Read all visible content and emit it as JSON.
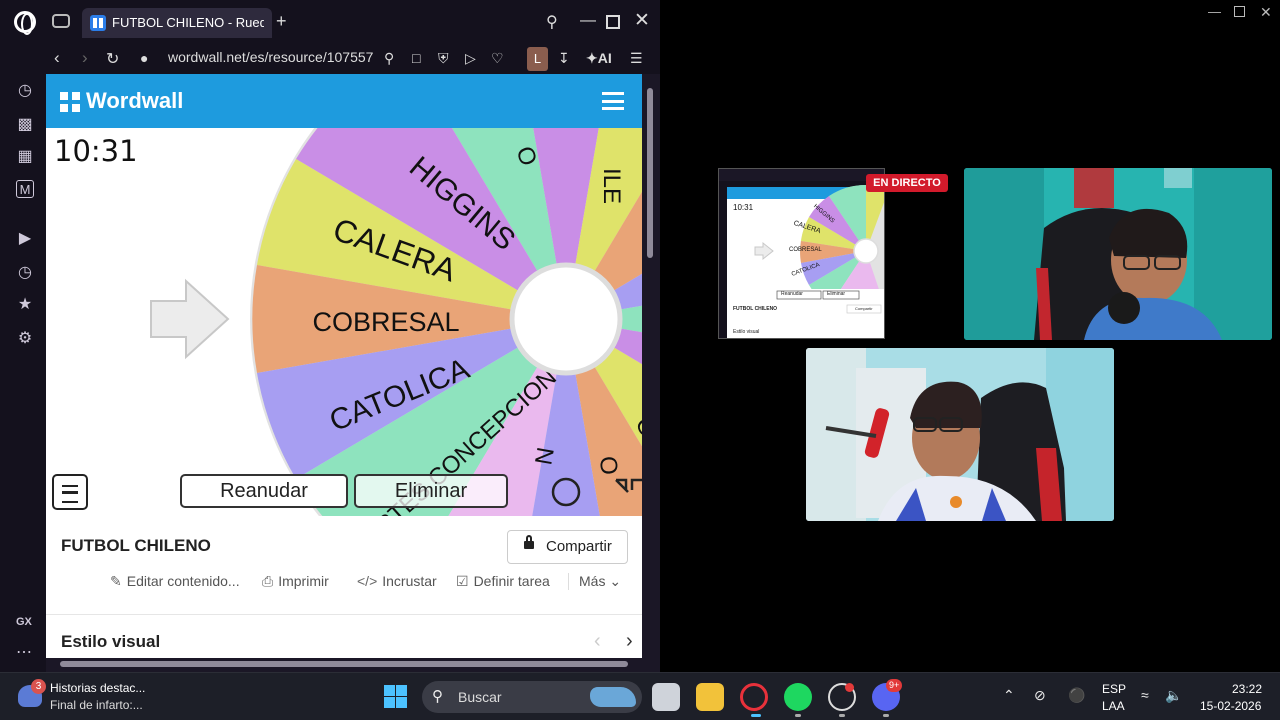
{
  "browser": {
    "tab_title": "FUTBOL CHILENO - Rueda",
    "url": "wordwall.net/es/resource/107557",
    "profile_initial": "L",
    "ai_label": "AI",
    "sidebar_gx": "GX"
  },
  "wordwall": {
    "logo": "Wordwall",
    "timer": "10:31",
    "wheel_segments": [
      "HIGGINS",
      "CALERA",
      "COBRESAL",
      "CATOLICA",
      "DEPORTES CONCEPCION"
    ],
    "wheel_top_fragments": [
      "O",
      "ILE",
      "V"
    ],
    "wheel_lower_fragments": [
      "N",
      "O",
      "Q",
      "NO"
    ],
    "resume_button": "Reanudar",
    "eliminate_button": "Eliminar",
    "activity_title": "FUTBOL CHILENO",
    "share_button": "Compartir",
    "actions": {
      "edit": "Editar contenido...",
      "print": "Imprimir",
      "embed": "Incrustar",
      "assign": "Definir tarea",
      "more": "Más"
    },
    "visual_style": "Estilo visual",
    "colors": {
      "header": "#1e9bde",
      "purple": "#c98ee6",
      "yellow": "#dfe36a",
      "orange": "#e9a477",
      "lavender": "#a79ef2",
      "mint": "#8ee3be"
    }
  },
  "stream": {
    "live_badge": "EN DIRECTO",
    "preview_title": "FUTBOL CHILENO",
    "preview_timer": "10:31",
    "preview_visual_style": "Estilo visual",
    "preview_segments": [
      "HIGGINS",
      "CALERA",
      "COBRESAL",
      "CATOLICA"
    ],
    "preview_resume": "Reanudar",
    "preview_eliminate": "Eliminar",
    "preview_share": "Compartir"
  },
  "taskbar": {
    "news_badge": "3",
    "news_line1": "Historias destac...",
    "news_line2": "Final de infarto:...",
    "search_placeholder": "Buscar",
    "lang_line1": "ESP",
    "lang_line2": "LAA",
    "time": "23:22",
    "date": "15-02-2026",
    "discord_badge": "9+"
  }
}
